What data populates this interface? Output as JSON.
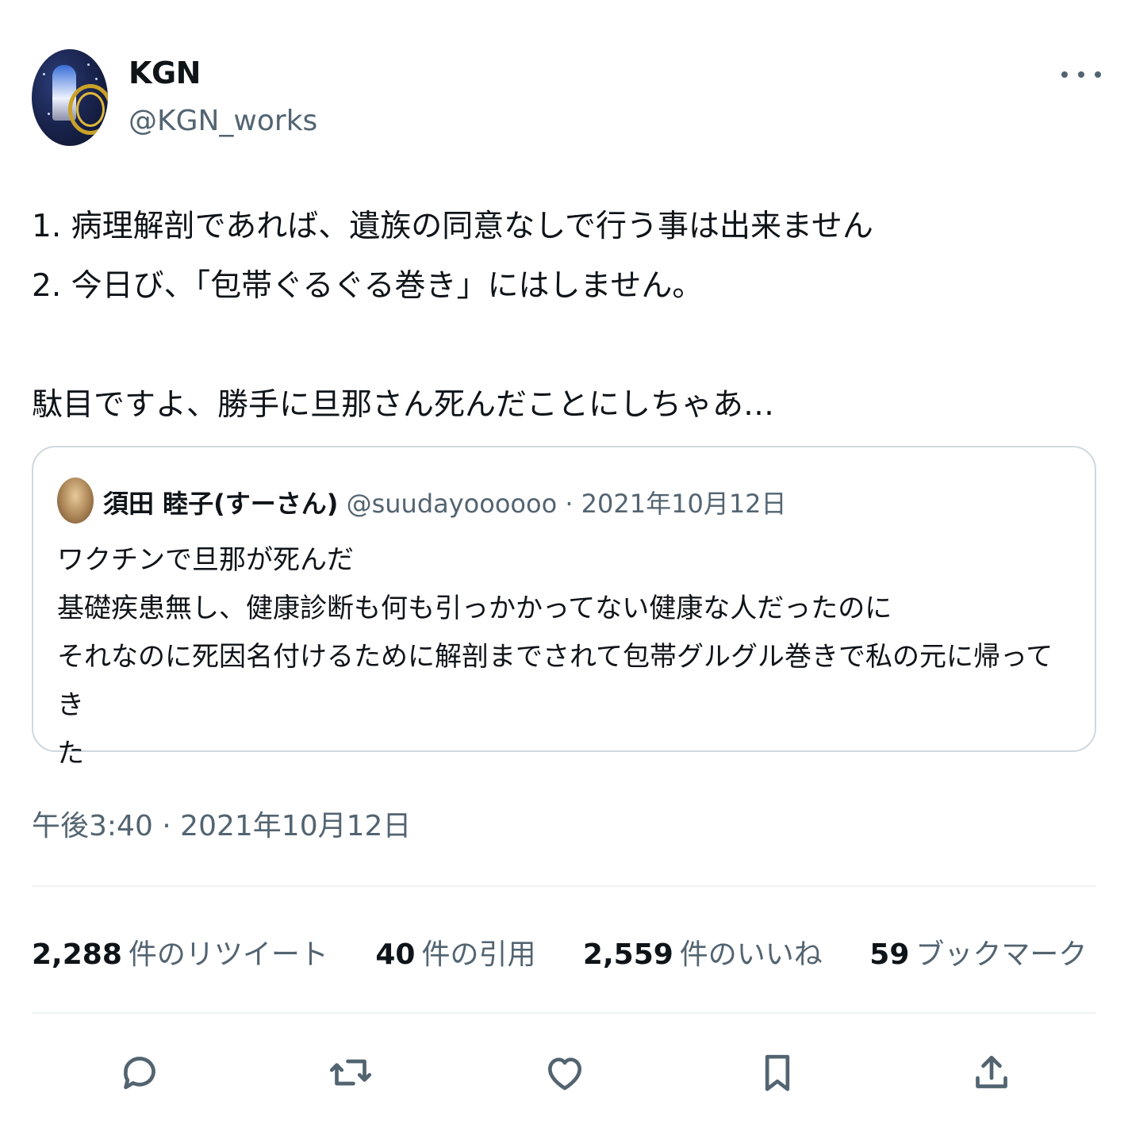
{
  "author": {
    "display_name": "KGN",
    "handle": "@KGN_works"
  },
  "tweet_text": "1. 病理解剖であれば、遺族の同意なしで行う事は出来ません\n2. 今日び、「包帯ぐるぐる巻き」にはしません。\n\n駄目ですよ、勝手に旦那さん死んだことにしちゃあ…",
  "quote": {
    "display_name": "須田 睦子(すーさん)",
    "handle": "@suudayoooooo",
    "separator": "·",
    "date": "2021年10月12日",
    "text": "ワクチンで旦那が死んだ\n基礎疾患無し、健康診断も何も引っかかってない健康な人だったのに\nそれなのに死因名付けるために解剖までされて包帯グルグル巻きで私の元に帰ってき\nた"
  },
  "timestamp": "午後3:40 · 2021年10月12日",
  "stats": [
    {
      "count": "2,288",
      "label": "件のリツイート"
    },
    {
      "count": "40",
      "label": "件の引用"
    },
    {
      "count": "2,559",
      "label": "件のいいね"
    },
    {
      "count": "59",
      "label": "ブックマーク"
    }
  ],
  "actions": [
    "reply-icon",
    "retweet-icon",
    "like-icon",
    "bookmark-icon",
    "share-icon"
  ],
  "colors": {
    "text": "#0f1419",
    "secondary": "#536471",
    "border": "#cfd9de",
    "divider": "#eff3f4"
  }
}
